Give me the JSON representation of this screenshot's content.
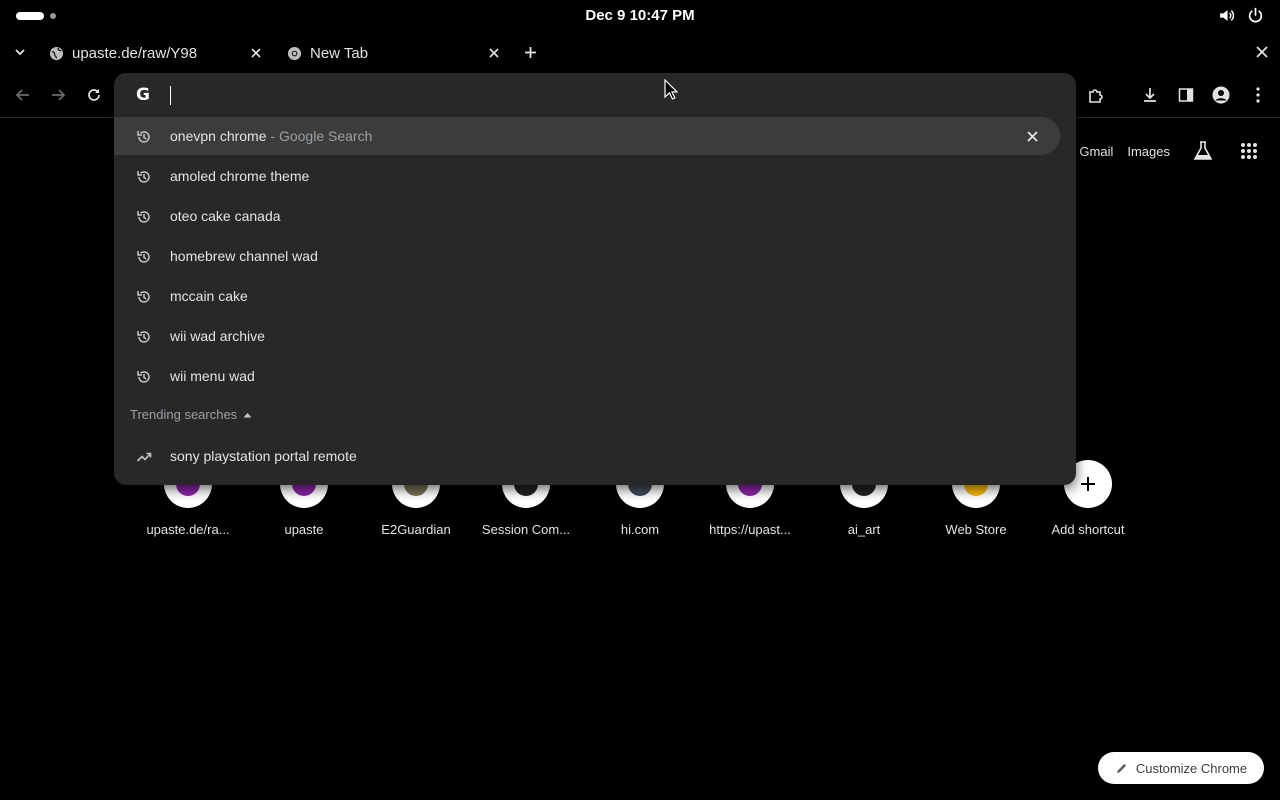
{
  "system_bar": {
    "clock": "Dec 9  10:47 PM",
    "icons": [
      "volume-icon",
      "power-icon"
    ]
  },
  "tabs": [
    {
      "title": "upaste.de/raw/Y98",
      "icon": "globe-icon",
      "active": false
    },
    {
      "title": "New Tab",
      "icon": "chrome-icon",
      "active": true
    }
  ],
  "toolbar": {
    "icons": [
      "back-icon",
      "forward-icon",
      "reload-icon",
      "extensions-icon",
      "download-icon",
      "side-panel-icon",
      "profile-icon",
      "menu-icon"
    ]
  },
  "omnibox": {
    "value": "",
    "placeholder": "",
    "provider_icon": "G",
    "suggestions": [
      {
        "text": "onevpn chrome",
        "suffix": " - Google Search",
        "icon": "history-icon",
        "selected": true
      },
      {
        "text": "amoled chrome theme",
        "suffix": "",
        "icon": "history-icon",
        "selected": false
      },
      {
        "text": "oteo cake canada",
        "suffix": "",
        "icon": "history-icon",
        "selected": false
      },
      {
        "text": "homebrew channel wad",
        "suffix": "",
        "icon": "history-icon",
        "selected": false
      },
      {
        "text": "mccain cake",
        "suffix": "",
        "icon": "history-icon",
        "selected": false
      },
      {
        "text": "wii wad archive",
        "suffix": "",
        "icon": "history-icon",
        "selected": false
      },
      {
        "text": "wii menu wad",
        "suffix": "",
        "icon": "history-icon",
        "selected": false
      }
    ],
    "trending_header": "Trending searches",
    "trending": [
      {
        "text": "sony playstation portal remote",
        "icon": "trending-icon"
      }
    ]
  },
  "ntp": {
    "header_links": [
      "Gmail",
      "Images"
    ],
    "shortcuts": [
      {
        "label": "upaste.de/ra...",
        "color": "#8e24aa"
      },
      {
        "label": "upaste",
        "color": "#8e24aa"
      },
      {
        "label": "E2Guardian",
        "color": "#7a7056"
      },
      {
        "label": "Session Com...",
        "color": "#222222"
      },
      {
        "label": "hi.com",
        "color": "#3c4a5a"
      },
      {
        "label": "https://upast...",
        "color": "#8e24aa"
      },
      {
        "label": "ai_art",
        "color": "#222222"
      },
      {
        "label": "Web Store",
        "color": "#fbbc04"
      },
      {
        "label": "Add shortcut",
        "color": ""
      }
    ],
    "customize_label": "Customize Chrome"
  }
}
